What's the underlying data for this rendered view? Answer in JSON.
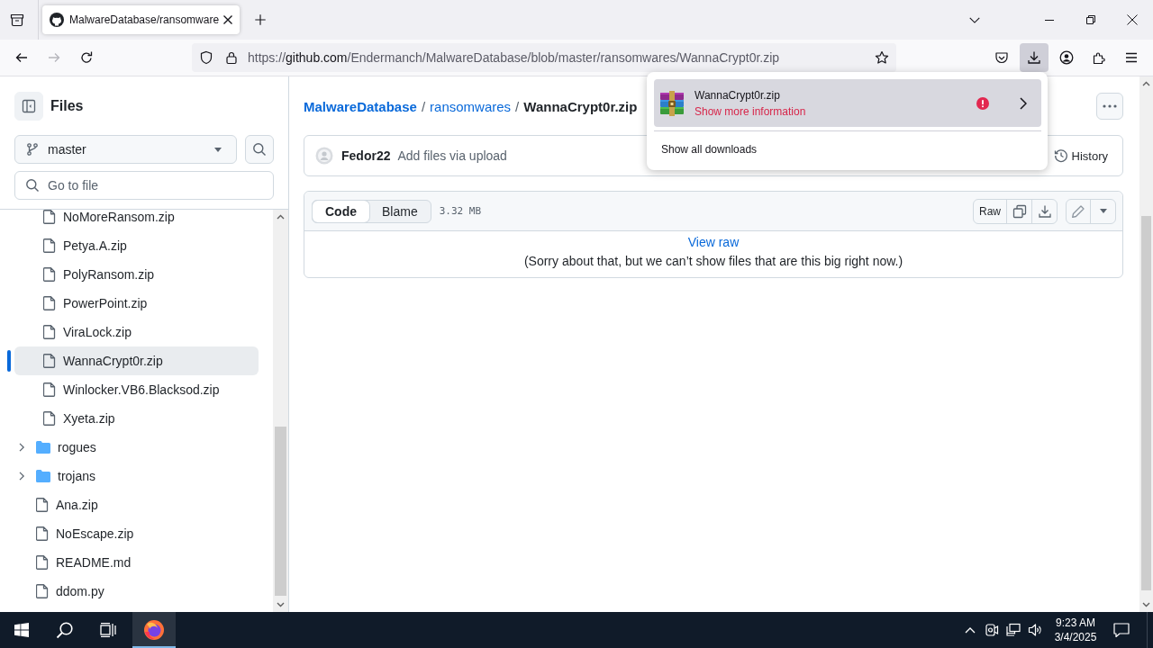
{
  "browser": {
    "tabs": [
      {
        "title": "MalwareDatabase/ransomware",
        "selected": true
      }
    ],
    "back_button": {
      "disabled": false
    },
    "forward_button": {
      "disabled": true
    },
    "url": {
      "scheme": "https://",
      "host": "github.com",
      "path": "/Endermanch/MalwareDatabase/blob/master/ransomwares/WannaCrypt0r.zip"
    },
    "downloads_button": {
      "active": true
    }
  },
  "downloads_panel": {
    "items": [
      {
        "name": "WannaCrypt0r.zip",
        "status": "Show more information",
        "warning": true,
        "selected": true
      }
    ],
    "footer": "Show all downloads"
  },
  "sidebar": {
    "title": "Files",
    "branch": "master",
    "search": {
      "placeholder": "Go to file"
    },
    "tree": [
      {
        "children": [
          {
            "kind": "file",
            "label": "NoMoreRansom.zip",
            "selected": false
          },
          {
            "kind": "file",
            "label": "Petya.A.zip",
            "selected": false
          },
          {
            "kind": "file",
            "label": "PolyRansom.zip",
            "selected": false
          },
          {
            "kind": "file",
            "label": "PowerPoint.zip",
            "selected": false
          },
          {
            "kind": "file",
            "label": "ViraLock.zip",
            "selected": false
          },
          {
            "kind": "file",
            "label": "WannaCrypt0r.zip",
            "selected": true
          },
          {
            "kind": "file",
            "label": "Winlocker.VB6.Blacksod.zip",
            "selected": false
          },
          {
            "kind": "file",
            "label": "Xyeta.zip",
            "selected": false
          }
        ]
      },
      {
        "kind": "folder",
        "label": "rogues",
        "expanded": false,
        "selected": false
      },
      {
        "kind": "folder",
        "label": "trojans",
        "expanded": false,
        "selected": false
      },
      {
        "kind": "file",
        "label": "Ana.zip",
        "selected": false
      },
      {
        "kind": "file",
        "label": "NoEscape.zip",
        "selected": false
      },
      {
        "kind": "file",
        "label": "README.md",
        "selected": false
      },
      {
        "kind": "file",
        "label": "ddom.py",
        "selected": false
      }
    ]
  },
  "breadcrumb": [
    {
      "kind": "repo",
      "text": "MalwareDatabase"
    },
    {
      "kind": "separator",
      "text": "/"
    },
    {
      "kind": "link",
      "text": "ransomwares"
    },
    {
      "kind": "separator",
      "text": "/"
    },
    {
      "kind": "current",
      "text": "WannaCrypt0r.zip"
    }
  ],
  "commit": {
    "author": "Fedor22",
    "message": "Add files via upload",
    "history": "History"
  },
  "file": {
    "view_tabs": [
      {
        "label": "Code",
        "selected": true
      },
      {
        "label": "Blame",
        "selected": false
      }
    ],
    "size": "3.32 MB",
    "raw": "Raw",
    "view_raw": "View raw",
    "notice": "(Sorry about that, but we can’t show files that are this big right now.)"
  },
  "taskbar": {
    "apps": [
      {
        "active": true
      }
    ],
    "time": "9:23 AM",
    "date": "3/4/2025"
  }
}
